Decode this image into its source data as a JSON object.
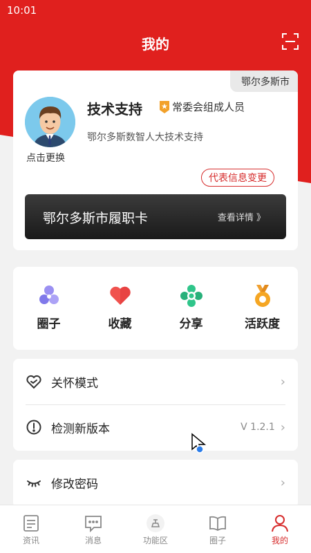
{
  "status": {
    "time": "10:01"
  },
  "header": {
    "title": "我的",
    "scan_icon": "scan-icon"
  },
  "profile": {
    "city": "鄂尔多斯市",
    "avatar_caption": "点击更换",
    "name": "技术支持",
    "role": "常委会组成人员",
    "description": "鄂尔多斯数智人大技术支持",
    "change_button": "代表信息变更",
    "duty_card": {
      "title": "鄂尔多斯市履职卡",
      "link": "查看详情 》"
    }
  },
  "features": [
    {
      "label": "圈子",
      "icon": "circle-icon"
    },
    {
      "label": "收藏",
      "icon": "heart-icon"
    },
    {
      "label": "分享",
      "icon": "share-icon"
    },
    {
      "label": "活跃度",
      "icon": "medal-icon"
    }
  ],
  "menu": [
    {
      "label": "关怀模式",
      "value": "",
      "icon": "care-heart-icon"
    },
    {
      "label": "检测新版本",
      "value": "V 1.2.1",
      "icon": "alert-icon"
    },
    {
      "label": "修改密码",
      "value": "",
      "icon": "eye-closed-icon"
    }
  ],
  "tabs": [
    {
      "label": "资讯",
      "icon": "news-icon",
      "active": false
    },
    {
      "label": "消息",
      "icon": "message-icon",
      "active": false
    },
    {
      "label": "功能区",
      "icon": "function-icon",
      "active": false
    },
    {
      "label": "圈子",
      "icon": "book-icon",
      "active": false
    },
    {
      "label": "我的",
      "icon": "user-icon",
      "active": true
    }
  ],
  "colors": {
    "primary": "#e0201e",
    "accent_text": "#d62b2b"
  }
}
